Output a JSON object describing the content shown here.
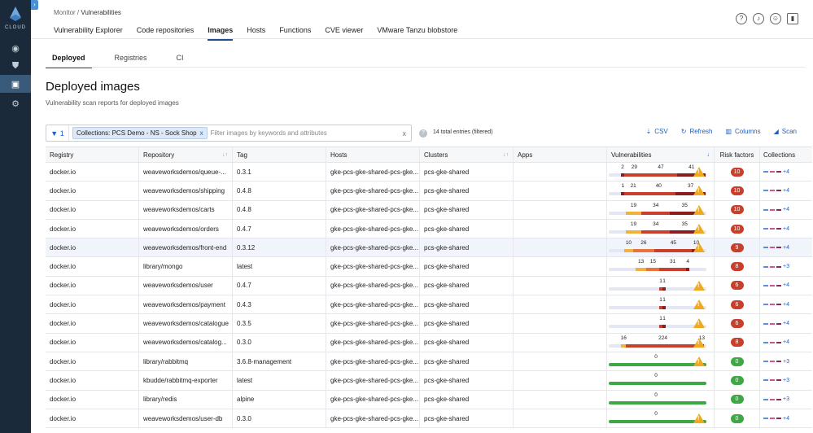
{
  "rail": {
    "logo_text": "CLOUD",
    "items": [
      "globe",
      "shield",
      "monitor",
      "gear"
    ]
  },
  "header": {
    "breadcrumb_root": "Monitor",
    "breadcrumb_sep": "/",
    "breadcrumb_current": "Vulnerabilities",
    "tabs": [
      "Vulnerability Explorer",
      "Code repositories",
      "Images",
      "Hosts",
      "Functions",
      "CVE viewer",
      "VMware Tanzu blobstore"
    ],
    "active_tab": "Images",
    "icons": [
      "help-icon",
      "bell-icon",
      "user-icon",
      "signal-icon"
    ]
  },
  "subtabs": [
    "Deployed",
    "Registries",
    "CI"
  ],
  "page": {
    "title": "Deployed images",
    "subtitle": "Vulnerability scan reports for deployed images"
  },
  "filter": {
    "count": "1",
    "chip": "Collections: PCS Demo - NS - Sock Shop",
    "chip_close": "x",
    "placeholder": "Filter images by keywords and attributes",
    "clear": "x",
    "entries": "14 total entries (filtered)"
  },
  "actions": {
    "csv": "CSV",
    "refresh": "Refresh",
    "columns": "Columns",
    "scan": "Scan"
  },
  "columns": [
    "Registry",
    "Repository",
    "Tag",
    "Hosts",
    "Clusters",
    "Apps",
    "Vulnerabilities",
    "Risk factors",
    "Collections"
  ],
  "colors": {
    "low": "#f0b23a",
    "medium": "#e8743b",
    "high": "#c8402c",
    "critical": "#8a1e1e",
    "none": "#3da844",
    "risk_red": "#c8402c",
    "risk_green": "#3da844",
    "brand": "#1f5fbf"
  },
  "rows": [
    {
      "registry": "docker.io",
      "repository": "weaveworksdemos/queue-...",
      "tag": "0.3.1",
      "hosts": "gke-pcs-gke-shared-pcs-gke...",
      "clusters": "pcs-gke-shared",
      "apps": "",
      "vuln": [
        {
          "label": "2",
          "sev": "critical",
          "v": 2
        },
        {
          "label": "29",
          "sev": "high",
          "v": 29
        },
        {
          "label": "47",
          "sev": "high",
          "v": 47
        },
        {
          "label": "41",
          "sev": "critical",
          "v": 41
        }
      ],
      "risk": "10",
      "risk_level": "red",
      "collections": "+4",
      "warn": true
    },
    {
      "registry": "docker.io",
      "repository": "weaveworksdemos/shipping",
      "tag": "0.4.8",
      "hosts": "gke-pcs-gke-shared-pcs-gke...",
      "clusters": "pcs-gke-shared",
      "apps": "",
      "vuln": [
        {
          "label": "1",
          "sev": "critical",
          "v": 1
        },
        {
          "label": "21",
          "sev": "high",
          "v": 21
        },
        {
          "label": "40",
          "sev": "high",
          "v": 40
        },
        {
          "label": "37",
          "sev": "critical",
          "v": 37
        }
      ],
      "risk": "10",
      "risk_level": "red",
      "collections": "+4",
      "warn": true
    },
    {
      "registry": "docker.io",
      "repository": "weaveworksdemos/carts",
      "tag": "0.4.8",
      "hosts": "gke-pcs-gke-shared-pcs-gke...",
      "clusters": "pcs-gke-shared",
      "apps": "",
      "vuln": [
        {
          "label": "19",
          "sev": "low",
          "v": 19
        },
        {
          "label": "34",
          "sev": "high",
          "v": 34
        },
        {
          "label": "35",
          "sev": "critical",
          "v": 35
        }
      ],
      "risk": "10",
      "risk_level": "red",
      "collections": "+4",
      "warn": true
    },
    {
      "registry": "docker.io",
      "repository": "weaveworksdemos/orders",
      "tag": "0.4.7",
      "hosts": "gke-pcs-gke-shared-pcs-gke...",
      "clusters": "pcs-gke-shared",
      "apps": "",
      "vuln": [
        {
          "label": "19",
          "sev": "low",
          "v": 19
        },
        {
          "label": "34",
          "sev": "high",
          "v": 34
        },
        {
          "label": "35",
          "sev": "critical",
          "v": 35
        }
      ],
      "risk": "10",
      "risk_level": "red",
      "collections": "+4",
      "warn": true
    },
    {
      "registry": "docker.io",
      "repository": "weaveworksdemos/front-end",
      "tag": "0.3.12",
      "hosts": "gke-pcs-gke-shared-pcs-gke...",
      "clusters": "pcs-gke-shared",
      "apps": "",
      "vuln": [
        {
          "label": "10",
          "sev": "low",
          "v": 10
        },
        {
          "label": "26",
          "sev": "medium",
          "v": 26
        },
        {
          "label": "45",
          "sev": "high",
          "v": 45
        },
        {
          "label": "10",
          "sev": "critical",
          "v": 10
        }
      ],
      "risk": "9",
      "risk_level": "red",
      "collections": "+4",
      "warn": true
    },
    {
      "registry": "docker.io",
      "repository": "library/mongo",
      "tag": "latest",
      "hosts": "gke-pcs-gke-shared-pcs-gke...",
      "clusters": "pcs-gke-shared",
      "apps": "",
      "vuln": [
        {
          "label": "13",
          "sev": "low",
          "v": 13
        },
        {
          "label": "15",
          "sev": "medium",
          "v": 15
        },
        {
          "label": "31",
          "sev": "high",
          "v": 31
        },
        {
          "label": "4",
          "sev": "critical",
          "v": 4
        }
      ],
      "risk": "8",
      "risk_level": "red",
      "collections": "+3",
      "warn": false
    },
    {
      "registry": "docker.io",
      "repository": "weaveworksdemos/user",
      "tag": "0.4.7",
      "hosts": "gke-pcs-gke-shared-pcs-gke...",
      "clusters": "pcs-gke-shared",
      "apps": "",
      "vuln": [
        {
          "label": "1",
          "sev": "high",
          "v": 1
        },
        {
          "label": "1",
          "sev": "critical",
          "v": 1
        }
      ],
      "risk": "6",
      "risk_level": "red",
      "collections": "+4",
      "warn": true
    },
    {
      "registry": "docker.io",
      "repository": "weaveworksdemos/payment",
      "tag": "0.4.3",
      "hosts": "gke-pcs-gke-shared-pcs-gke...",
      "clusters": "pcs-gke-shared",
      "apps": "",
      "vuln": [
        {
          "label": "1",
          "sev": "high",
          "v": 1
        },
        {
          "label": "1",
          "sev": "critical",
          "v": 1
        }
      ],
      "risk": "6",
      "risk_level": "red",
      "collections": "+4",
      "warn": true
    },
    {
      "registry": "docker.io",
      "repository": "weaveworksdemos/catalogue",
      "tag": "0.3.5",
      "hosts": "gke-pcs-gke-shared-pcs-gke...",
      "clusters": "pcs-gke-shared",
      "apps": "",
      "vuln": [
        {
          "label": "1",
          "sev": "high",
          "v": 1
        },
        {
          "label": "1",
          "sev": "critical",
          "v": 1
        }
      ],
      "risk": "6",
      "risk_level": "red",
      "collections": "+4",
      "warn": true
    },
    {
      "registry": "docker.io",
      "repository": "weaveworksdemos/catalog...",
      "tag": "0.3.0",
      "hosts": "gke-pcs-gke-shared-pcs-gke...",
      "clusters": "pcs-gke-shared",
      "apps": "",
      "vuln": [
        {
          "label": "16",
          "sev": "low",
          "v": 16
        },
        {
          "label": "224",
          "sev": "high",
          "v": 224
        },
        {
          "label": "13",
          "sev": "critical",
          "v": 13
        }
      ],
      "risk": "8",
      "risk_level": "red",
      "collections": "+4",
      "warn": true
    },
    {
      "registry": "docker.io",
      "repository": "library/rabbitmq",
      "tag": "3.6.8-management",
      "hosts": "gke-pcs-gke-shared-pcs-gke...",
      "clusters": "pcs-gke-shared",
      "apps": "",
      "vuln": [
        {
          "label": "0",
          "sev": "none",
          "v": 1
        }
      ],
      "risk": "0",
      "risk_level": "green",
      "collections": "+3",
      "warn": true
    },
    {
      "registry": "docker.io",
      "repository": "kbudde/rabbitmq-exporter",
      "tag": "latest",
      "hosts": "gke-pcs-gke-shared-pcs-gke...",
      "clusters": "pcs-gke-shared",
      "apps": "",
      "vuln": [
        {
          "label": "0",
          "sev": "none",
          "v": 1
        }
      ],
      "risk": "0",
      "risk_level": "green",
      "collections": "+3",
      "warn": false
    },
    {
      "registry": "docker.io",
      "repository": "library/redis",
      "tag": "alpine",
      "hosts": "gke-pcs-gke-shared-pcs-gke...",
      "clusters": "pcs-gke-shared",
      "apps": "",
      "vuln": [
        {
          "label": "0",
          "sev": "none",
          "v": 1
        }
      ],
      "risk": "0",
      "risk_level": "green",
      "collections": "+3",
      "warn": false
    },
    {
      "registry": "docker.io",
      "repository": "weaveworksdemos/user-db",
      "tag": "0.3.0",
      "hosts": "gke-pcs-gke-shared-pcs-gke...",
      "clusters": "pcs-gke-shared",
      "apps": "",
      "vuln": [
        {
          "label": "0",
          "sev": "none",
          "v": 1
        }
      ],
      "risk": "0",
      "risk_level": "green",
      "collections": "+4",
      "warn": true
    }
  ]
}
